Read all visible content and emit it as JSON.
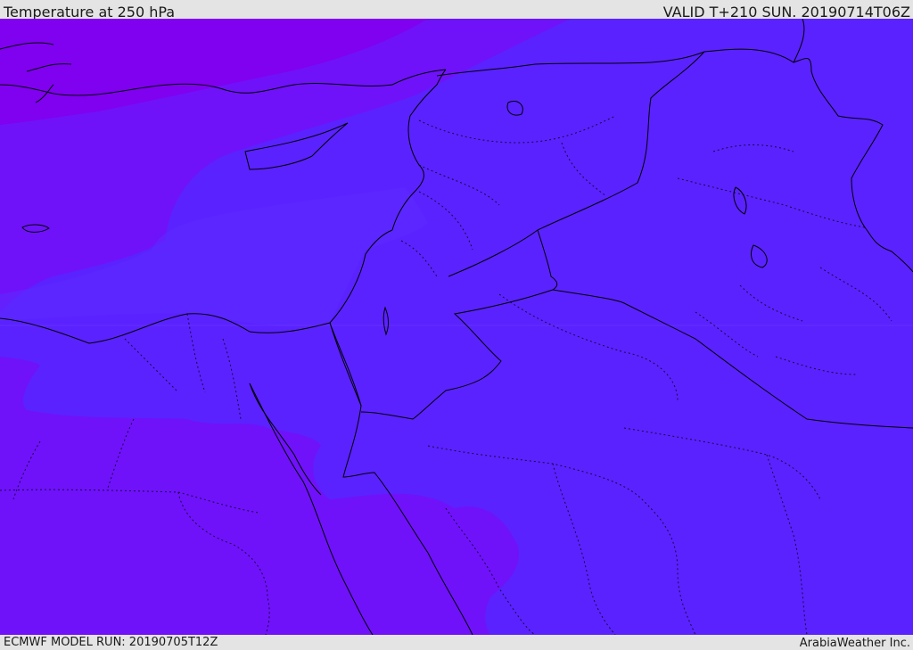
{
  "header": {
    "title": "Temperature at 250 hPa",
    "valid": "VALID T+210 SUN. 20190714T06Z"
  },
  "footer": {
    "model_run": "ECMWF MODEL RUN: 20190705T12Z",
    "brand": "ArabiaWeather Inc."
  },
  "map": {
    "colors": {
      "violet_dark": "#8000f0",
      "violet_mid": "#6f12fa",
      "blue_violet": "#5a22ff",
      "background": "#5a22ff",
      "coast_line": "#000000",
      "border_line": "#000000"
    },
    "icon": "weather-map"
  }
}
